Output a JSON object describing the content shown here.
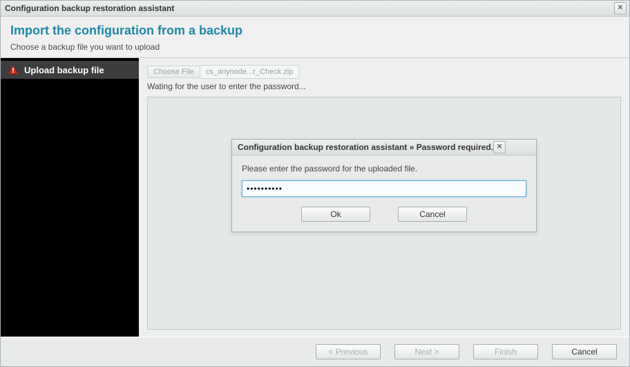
{
  "window": {
    "title": "Configuration backup restoration assistant"
  },
  "header": {
    "title": "Import the configuration from a backup",
    "subtitle": "Choose a backup file you want to upload"
  },
  "sidebar": {
    "steps": [
      {
        "label": "Upload backup file"
      }
    ]
  },
  "main": {
    "choose_file_label": "Choose File",
    "file_name": "cs_anynode...r_Check.zip",
    "status_text": "Wating for the user to enter the password..."
  },
  "footer": {
    "previous_label": "< Previous",
    "next_label": "Next >",
    "finish_label": "Finish",
    "cancel_label": "Cancel"
  },
  "modal": {
    "title": "Configuration backup restoration assistant » Password required.",
    "message": "Please enter the password for the uploaded file.",
    "password_value": "••••••••••",
    "ok_label": "Ok",
    "cancel_label": "Cancel"
  }
}
